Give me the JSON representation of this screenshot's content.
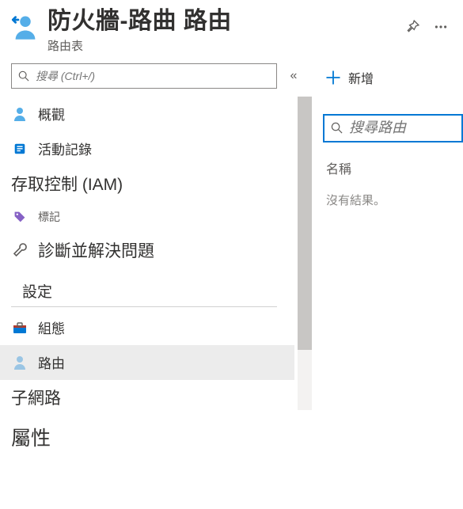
{
  "header": {
    "title": "防火牆-路曲 路由",
    "subtitle": "路由表"
  },
  "sidebar": {
    "search_placeholder": "搜尋 (Ctrl+/)",
    "items": [
      {
        "label": "概觀",
        "icon": "overview"
      },
      {
        "label": "活動記錄",
        "icon": "activity-log"
      },
      {
        "label": "存取控制 (IAM)",
        "icon": "none",
        "large": true
      },
      {
        "label": "標記",
        "icon": "tag",
        "small": true
      },
      {
        "label": "診斷並解決問題",
        "icon": "diagnose",
        "large": true
      }
    ],
    "section_label": "設定",
    "settings_items": [
      {
        "label": "組態",
        "icon": "config"
      },
      {
        "label": "路由",
        "icon": "routes",
        "selected": true
      },
      {
        "label": "子網路",
        "icon": "none",
        "large": true
      }
    ],
    "properties_label": "屬性"
  },
  "toolbar": {
    "add_label": "新增"
  },
  "routes": {
    "filter_placeholder": "搜尋路由",
    "column_name": "名稱",
    "empty": "沒有結果。"
  }
}
